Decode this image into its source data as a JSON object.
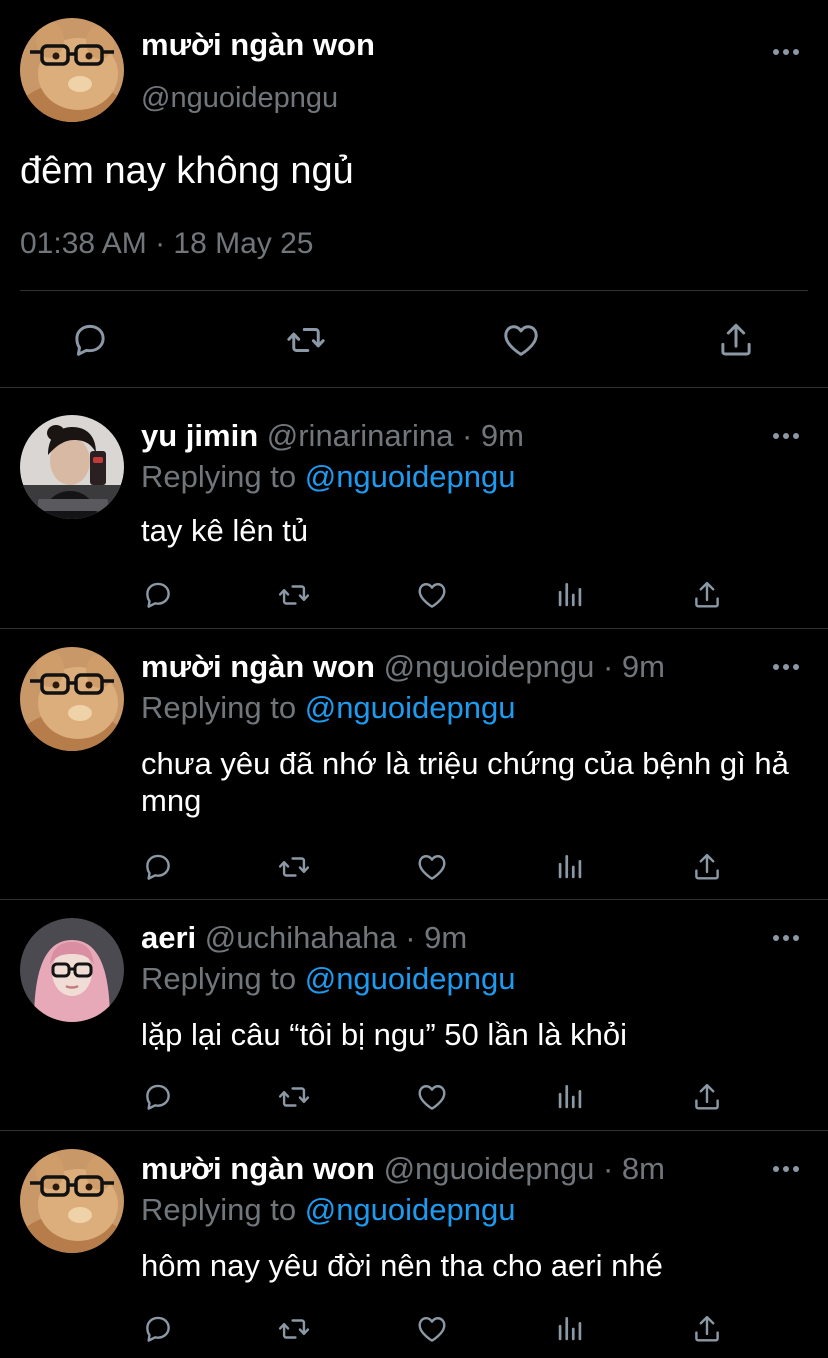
{
  "main_tweet": {
    "author_name": "mười ngàn won",
    "author_handle": "@nguoidepngu",
    "text": "đêm nay không ngủ",
    "timestamp": "01:38 AM · 18 May 25",
    "avatar_icon": "cat-with-glasses-avatar",
    "actions": [
      "reply-icon",
      "retweet-icon",
      "like-icon",
      "share-icon"
    ]
  },
  "replies": [
    {
      "author_name": "yu jimin",
      "author_handle": "@rinarinarina",
      "separator": "·",
      "time": "9m",
      "replying_label": "Replying to",
      "replying_mention": "@nguoidepngu",
      "text": "tay kê lên tủ",
      "avatar_icon": "woman-portrait-avatar"
    },
    {
      "author_name": "mười ngàn won",
      "author_handle": "@nguoidepngu",
      "separator": "·",
      "time": "9m",
      "replying_label": "Replying to",
      "replying_mention": "@nguoidepngu",
      "text": "chưa yêu đã nhớ là triệu chứng của bệnh gì hả mng",
      "avatar_icon": "cat-with-glasses-avatar"
    },
    {
      "author_name": "aeri",
      "author_handle": "@uchihahaha",
      "separator": "·",
      "time": "9m",
      "replying_label": "Replying to",
      "replying_mention": "@nguoidepngu",
      "text": "lặp lại câu “tôi bị ngu” 50 lần là khỏi",
      "avatar_icon": "pink-hair-glasses-avatar"
    },
    {
      "author_name": "mười ngàn won",
      "author_handle": "@nguoidepngu",
      "separator": "·",
      "time": "8m",
      "replying_label": "Replying to",
      "replying_mention": "@nguoidepngu",
      "text": "hôm nay yêu đời nên tha cho aeri nhé",
      "avatar_icon": "cat-with-glasses-avatar"
    }
  ],
  "colors": {
    "background": "#000000",
    "text_primary": "#ffffff",
    "text_secondary": "#71767b",
    "link": "#1d9bf0",
    "divider": "#2f3336"
  }
}
